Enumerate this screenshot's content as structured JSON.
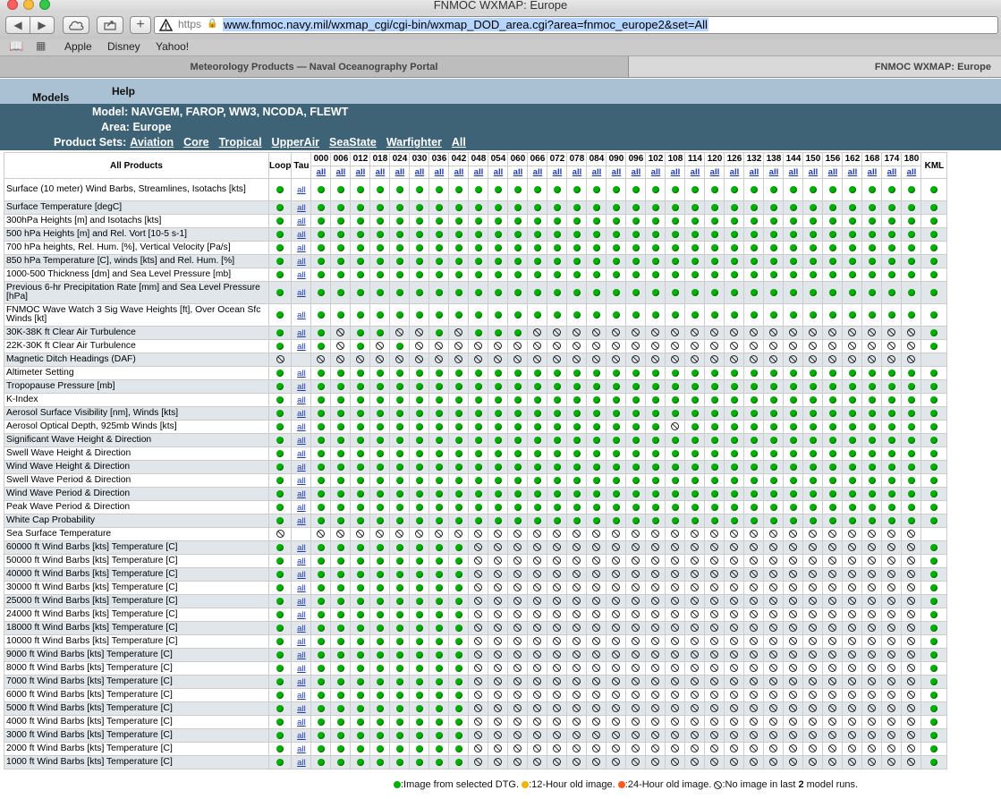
{
  "window": {
    "title": "FNMOC WXMAP: Europe"
  },
  "browser": {
    "url_protocol": "https",
    "url": "www.fnmoc.navy.mil/wxmap_cgi/cgi-bin/wxmap_DOD_area.cgi?area=fnmoc_europe2&set=All",
    "bookmarks": [
      "Apple",
      "Disney",
      "Yahoo!"
    ],
    "tabs": [
      "Meteorology Products — Naval Oceanography Portal",
      "FNMOC WXMAP: Europe"
    ]
  },
  "nav": {
    "models_label": "Models",
    "help_label": "Help"
  },
  "info": {
    "model_label": "Model:",
    "model_value": "NAVGEM, FAROP, WW3, NCODA, FLEWT",
    "area_label": "Area:",
    "area_value": "Europe",
    "sets_label": "Product Sets:",
    "sets": [
      "Aviation",
      "Core",
      "Tropical",
      "UpperAir",
      "SeaState",
      "Warfighter",
      "All"
    ]
  },
  "table": {
    "header_products": "All Products",
    "header_loop": "Loop",
    "header_tau": "Tau",
    "header_kml": "KML",
    "all_link": "all",
    "taus": [
      "000",
      "006",
      "012",
      "018",
      "024",
      "030",
      "036",
      "042",
      "048",
      "054",
      "060",
      "066",
      "072",
      "078",
      "084",
      "090",
      "096",
      "102",
      "108",
      "114",
      "120",
      "126",
      "132",
      "138",
      "144",
      "150",
      "156",
      "162",
      "168",
      "174",
      "180"
    ],
    "rows": [
      {
        "name": "Surface (10 meter) Wind Barbs, Streamlines, Isotachs [kts]",
        "loop": "g",
        "tau_link": true,
        "cells": "ggggggggggggggggggggggggggggggg",
        "kml": "g"
      },
      {
        "name": "Surface Temperature [degC]",
        "loop": "g",
        "tau_link": true,
        "cells": "ggggggggggggggggggggggggggggggg",
        "kml": "g"
      },
      {
        "name": "300hPa Heights [m] and Isotachs [kts]",
        "loop": "g",
        "tau_link": true,
        "cells": "ggggggggggggggggggggggggggggggg",
        "kml": "g"
      },
      {
        "name": "500 hPa Heights [m] and Rel. Vort [10-5 s-1]",
        "loop": "g",
        "tau_link": true,
        "cells": "ggggggggggggggggggggggggggggggg",
        "kml": "g"
      },
      {
        "name": "700 hPa heights, Rel. Hum. [%], Vertical Velocity [Pa/s]",
        "loop": "g",
        "tau_link": true,
        "cells": "ggggggggggggggggggggggggggggggg",
        "kml": "g"
      },
      {
        "name": "850 hPa Temperature [C], winds [kts] and Rel. Hum. [%]",
        "loop": "g",
        "tau_link": true,
        "cells": "ggggggggggggggggggggggggggggggg",
        "kml": "g"
      },
      {
        "name": "1000-500 Thickness [dm] and Sea Level Pressure [mb]",
        "loop": "g",
        "tau_link": true,
        "cells": "ggggggggggggggggggggggggggggggg",
        "kml": "g"
      },
      {
        "name": "Previous 6-hr Precipitation Rate [mm] and Sea Level Pressure [hPa]",
        "loop": "g",
        "tau_link": true,
        "cells": "ggggggggggggggggggggggggggggggg",
        "kml": "g"
      },
      {
        "name": "FNMOC Wave Watch 3 Sig Wave Heights [ft], Over Ocean Sfc Winds [kt]",
        "loop": "g",
        "tau_link": true,
        "cells": "ggggggggggggggggggggggggggggggg",
        "kml": "g"
      },
      {
        "name": "30K-38K ft Clear Air Turbulence",
        "loop": "g",
        "tau_link": true,
        "cells": "gxggxxgxgggxxxxxxxxxxxxxxxxxxxx",
        "kml": "g"
      },
      {
        "name": "22K-30K ft Clear Air Turbulence",
        "loop": "g",
        "tau_link": true,
        "cells": "gxgxgxxxxxxxxxxxxxxxxxxxxxxxxxx",
        "kml": "g"
      },
      {
        "name": "Magnetic Ditch Headings (DAF)",
        "loop": "x",
        "tau_link": false,
        "cells": "xxxxxxxxxxxxxxxxxxxxxxxxxxxxxxx",
        "kml": ""
      },
      {
        "name": "Altimeter Setting",
        "loop": "g",
        "tau_link": true,
        "cells": "ggggggggggggggggggggggggggggggg",
        "kml": "g"
      },
      {
        "name": "Tropopause Pressure [mb]",
        "loop": "g",
        "tau_link": true,
        "cells": "ggggggggggggggggggggggggggggggg",
        "kml": "g"
      },
      {
        "name": "K-Index",
        "loop": "g",
        "tau_link": true,
        "cells": "ggggggggggggggggggggggggggggggg",
        "kml": "g"
      },
      {
        "name": "Aerosol Surface Visibility [nm], Winds [kts]",
        "loop": "g",
        "tau_link": true,
        "cells": "ggggggggggggggggggggggggggggggg",
        "kml": "g"
      },
      {
        "name": "Aerosol Optical Depth, 925mb Winds [kts]",
        "loop": "g",
        "tau_link": true,
        "cells": "ggggggggggggggggggxgggggggggggg",
        "kml": "g"
      },
      {
        "name": "Significant Wave Height & Direction",
        "loop": "g",
        "tau_link": true,
        "cells": "ggggggggggggggggggggggggggggggg",
        "kml": "g"
      },
      {
        "name": "Swell Wave Height & Direction",
        "loop": "g",
        "tau_link": true,
        "cells": "ggggggggggggggggggggggggggggggg",
        "kml": "g"
      },
      {
        "name": "Wind Wave Height & Direction",
        "loop": "g",
        "tau_link": true,
        "cells": "ggggggggggggggggggggggggggggggg",
        "kml": "g"
      },
      {
        "name": "Swell Wave Period & Direction",
        "loop": "g",
        "tau_link": true,
        "cells": "ggggggggggggggggggggggggggggggg",
        "kml": "g"
      },
      {
        "name": "Wind Wave Period & Direction",
        "loop": "g",
        "tau_link": true,
        "cells": "ggggggggggggggggggggggggggggggg",
        "kml": "g"
      },
      {
        "name": "Peak Wave Period & Direction",
        "loop": "g",
        "tau_link": true,
        "cells": "ggggggggggggggggggggggggggggggg",
        "kml": "g"
      },
      {
        "name": "White Cap Probability",
        "loop": "g",
        "tau_link": true,
        "cells": "ggggggggggggggggggggggggggggggg",
        "kml": "g"
      },
      {
        "name": "Sea Surface Temperature",
        "loop": "x",
        "tau_link": false,
        "cells": "xxxxxxxxxxxxxxxxxxxxxxxxxxxxxxx",
        "kml": ""
      },
      {
        "name": "60000 ft Wind Barbs [kts] Temperature [C]",
        "loop": "g",
        "tau_link": true,
        "cells": "ggggggggxxxxxxxxxxxxxxxxxxxxxxx",
        "kml": "g"
      },
      {
        "name": "50000 ft Wind Barbs [kts] Temperature [C]",
        "loop": "g",
        "tau_link": true,
        "cells": "ggggggggxxxxxxxxxxxxxxxxxxxxxxx",
        "kml": "g"
      },
      {
        "name": "40000 ft Wind Barbs [kts] Temperature [C]",
        "loop": "g",
        "tau_link": true,
        "cells": "ggggggggxxxxxxxxxxxxxxxxxxxxxxx",
        "kml": "g"
      },
      {
        "name": "30000 ft Wind Barbs [kts] Temperature [C]",
        "loop": "g",
        "tau_link": true,
        "cells": "ggggggggxxxxxxxxxxxxxxxxxxxxxxx",
        "kml": "g"
      },
      {
        "name": "25000 ft Wind Barbs [kts] Temperature [C]",
        "loop": "g",
        "tau_link": true,
        "cells": "ggggggggxxxxxxxxxxxxxxxxxxxxxxx",
        "kml": "g"
      },
      {
        "name": "24000 ft Wind Barbs [kts] Temperature [C]",
        "loop": "g",
        "tau_link": true,
        "cells": "ggggggggxxxxxxxxxxxxxxxxxxxxxxx",
        "kml": "g"
      },
      {
        "name": "18000 ft Wind Barbs [kts] Temperature [C]",
        "loop": "g",
        "tau_link": true,
        "cells": "ggggggggxxxxxxxxxxxxxxxxxxxxxxx",
        "kml": "g"
      },
      {
        "name": "10000 ft Wind Barbs [kts] Temperature [C]",
        "loop": "g",
        "tau_link": true,
        "cells": "ggggggggxxxxxxxxxxxxxxxxxxxxxxx",
        "kml": "g"
      },
      {
        "name": "9000 ft Wind Barbs [kts] Temperature [C]",
        "loop": "g",
        "tau_link": true,
        "cells": "ggggggggxxxxxxxxxxxxxxxxxxxxxxx",
        "kml": "g"
      },
      {
        "name": "8000 ft Wind Barbs [kts] Temperature [C]",
        "loop": "g",
        "tau_link": true,
        "cells": "ggggggggxxxxxxxxxxxxxxxxxxxxxxx",
        "kml": "g"
      },
      {
        "name": "7000 ft Wind Barbs [kts] Temperature [C]",
        "loop": "g",
        "tau_link": true,
        "cells": "ggggggggxxxxxxxxxxxxxxxxxxxxxxx",
        "kml": "g"
      },
      {
        "name": "6000 ft Wind Barbs [kts] Temperature [C]",
        "loop": "g",
        "tau_link": true,
        "cells": "ggggggggxxxxxxxxxxxxxxxxxxxxxxx",
        "kml": "g"
      },
      {
        "name": "5000 ft Wind Barbs [kts] Temperature [C]",
        "loop": "g",
        "tau_link": true,
        "cells": "ggggggggxxxxxxxxxxxxxxxxxxxxxxx",
        "kml": "g"
      },
      {
        "name": "4000 ft Wind Barbs [kts] Temperature [C]",
        "loop": "g",
        "tau_link": true,
        "cells": "ggggggggxxxxxxxxxxxxxxxxxxxxxxx",
        "kml": "g"
      },
      {
        "name": "3000 ft Wind Barbs [kts] Temperature [C]",
        "loop": "g",
        "tau_link": true,
        "cells": "ggggggggxxxxxxxxxxxxxxxxxxxxxxx",
        "kml": "g"
      },
      {
        "name": "2000 ft Wind Barbs [kts] Temperature [C]",
        "loop": "g",
        "tau_link": true,
        "cells": "ggggggggxxxxxxxxxxxxxxxxxxxxxxx",
        "kml": "g"
      },
      {
        "name": "1000 ft Wind Barbs [kts] Temperature [C]",
        "loop": "g",
        "tau_link": true,
        "cells": "ggggggggxxxxxxxxxxxxxxxxxxxxxxx",
        "kml": "g"
      }
    ]
  },
  "legend": {
    "selected": ":Image from selected DTG.",
    "old12": ":12-Hour old image.",
    "old24": ":24-Hour old image.",
    "none_prefix": ":No image in last ",
    "none_count": "2",
    "none_suffix": " model runs."
  },
  "colors": {
    "green": "#00b000",
    "orange12": "#f0b400",
    "orange24": "#ff5a1e",
    "nav_bg": "#a9c1d2",
    "info_bg": "#3f6376",
    "row_alt": "#e0e6ea"
  }
}
